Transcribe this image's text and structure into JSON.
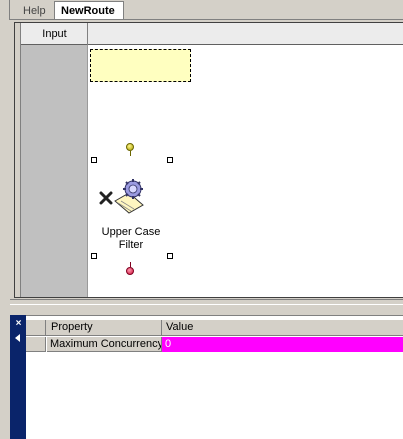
{
  "tabs": [
    {
      "label": "Help",
      "active": false
    },
    {
      "label": "NewRoute",
      "active": true
    }
  ],
  "canvas": {
    "lane_header": "Input",
    "component": {
      "label": "Upper Case\nFilter",
      "icon": "filter-gear-icon"
    }
  },
  "properties": {
    "close_glyph": "×",
    "columns": {
      "name": "Property",
      "value": "Value"
    },
    "rows": [
      {
        "name": "Maximum Concurrency",
        "value": "0",
        "value_bg": "#ff00ff"
      }
    ]
  },
  "colors": {
    "note_bg": "#ffffc0",
    "side_strip": "#0a246a",
    "value_highlight": "#ff00ff"
  }
}
